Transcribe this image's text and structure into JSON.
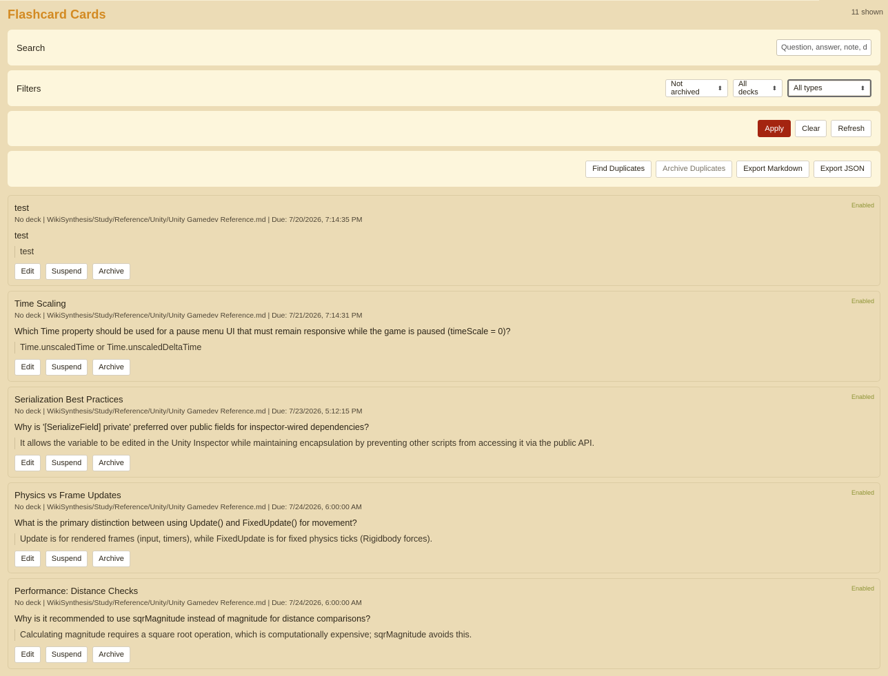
{
  "header": {
    "title": "Flashcard Cards",
    "count": "11 shown"
  },
  "search": {
    "label": "Search",
    "placeholder": "Question, answer, note, deck"
  },
  "filters": {
    "label": "Filters",
    "archived": "Not archived",
    "decks": "All decks",
    "types": "All types"
  },
  "actions": {
    "apply": "Apply",
    "clear": "Clear",
    "refresh": "Refresh"
  },
  "tools": {
    "find_duplicates": "Find Duplicates",
    "archive_duplicates": "Archive Duplicates",
    "export_markdown": "Export Markdown",
    "export_json": "Export JSON"
  },
  "card_buttons": {
    "edit": "Edit",
    "suspend": "Suspend",
    "archive": "Archive"
  },
  "cards": [
    {
      "title": "test",
      "status": "Enabled",
      "meta": "No deck | WikiSynthesis/Study/Reference/Unity/Unity Gamedev Reference.md | Due: 7/20/2026, 7:14:35 PM",
      "question": "test",
      "answer": "test"
    },
    {
      "title": "Time Scaling",
      "status": "Enabled",
      "meta": "No deck | WikiSynthesis/Study/Reference/Unity/Unity Gamedev Reference.md | Due: 7/21/2026, 7:14:31 PM",
      "question": "Which Time property should be used for a pause menu UI that must remain responsive while the game is paused (timeScale = 0)?",
      "answer": "Time.unscaledTime or Time.unscaledDeltaTime"
    },
    {
      "title": "Serialization Best Practices",
      "status": "Enabled",
      "meta": "No deck | WikiSynthesis/Study/Reference/Unity/Unity Gamedev Reference.md | Due: 7/23/2026, 5:12:15 PM",
      "question": "Why is '[SerializeField] private' preferred over public fields for inspector-wired dependencies?",
      "answer": "It allows the variable to be edited in the Unity Inspector while maintaining encapsulation by preventing other scripts from accessing it via the public API."
    },
    {
      "title": "Physics vs Frame Updates",
      "status": "Enabled",
      "meta": "No deck | WikiSynthesis/Study/Reference/Unity/Unity Gamedev Reference.md | Due: 7/24/2026, 6:00:00 AM",
      "question": "What is the primary distinction between using Update() and FixedUpdate() for movement?",
      "answer": "Update is for rendered frames (input, timers), while FixedUpdate is for fixed physics ticks (Rigidbody forces)."
    },
    {
      "title": "Performance: Distance Checks",
      "status": "Enabled",
      "meta": "No deck | WikiSynthesis/Study/Reference/Unity/Unity Gamedev Reference.md | Due: 7/24/2026, 6:00:00 AM",
      "question": "Why is it recommended to use sqrMagnitude instead of magnitude for distance comparisons?",
      "answer": "Calculating magnitude requires a square root operation, which is computationally expensive; sqrMagnitude avoids this."
    }
  ]
}
